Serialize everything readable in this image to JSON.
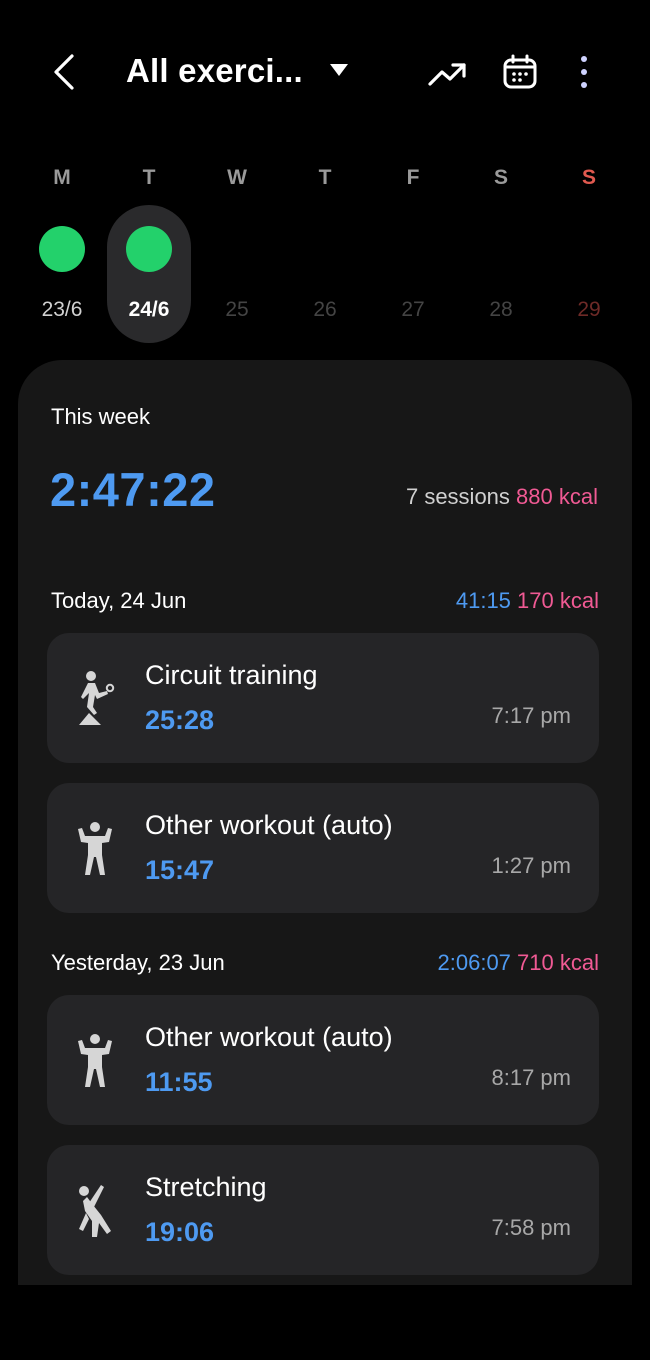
{
  "header": {
    "title": "All exerci...",
    "icons": [
      "back-icon",
      "trend-icon",
      "calendar-icon",
      "more-icon"
    ]
  },
  "week": {
    "days": [
      {
        "letter": "M",
        "date": "23/6",
        "has_workout": true,
        "selected": false
      },
      {
        "letter": "T",
        "date": "24/6",
        "has_workout": true,
        "selected": true
      },
      {
        "letter": "W",
        "date": "25",
        "has_workout": false,
        "selected": false
      },
      {
        "letter": "T",
        "date": "26",
        "has_workout": false,
        "selected": false
      },
      {
        "letter": "F",
        "date": "27",
        "has_workout": false,
        "selected": false
      },
      {
        "letter": "S",
        "date": "28",
        "has_workout": false,
        "selected": false
      },
      {
        "letter": "S",
        "date": "29",
        "has_workout": false,
        "selected": false
      }
    ]
  },
  "summary": {
    "label": "This week",
    "total": "2:47:22",
    "sessions": "7 sessions",
    "kcal": "880 kcal"
  },
  "groups": [
    {
      "label": "Today, 24 Jun",
      "duration": "41:15",
      "kcal": "170 kcal",
      "items": [
        {
          "name": "Circuit training",
          "duration": "25:28",
          "time": "7:17 pm",
          "icon": "circuit-training-icon"
        },
        {
          "name": "Other workout (auto)",
          "duration": "15:47",
          "time": "1:27 pm",
          "icon": "workout-person-icon"
        }
      ]
    },
    {
      "label": "Yesterday, 23 Jun",
      "duration": "2:06:07",
      "kcal": "710 kcal",
      "items": [
        {
          "name": "Other workout (auto)",
          "duration": "11:55",
          "time": "8:17 pm",
          "icon": "workout-person-icon"
        },
        {
          "name": "Stretching",
          "duration": "19:06",
          "time": "7:58 pm",
          "icon": "stretching-icon"
        }
      ]
    }
  ],
  "colors": {
    "accent_blue": "#4e9af1",
    "kcal_pink": "#f05a94",
    "dot_green": "#23d16b",
    "sunday_red": "#e0594f",
    "card_bg": "#252527",
    "panel_bg": "#171717"
  }
}
